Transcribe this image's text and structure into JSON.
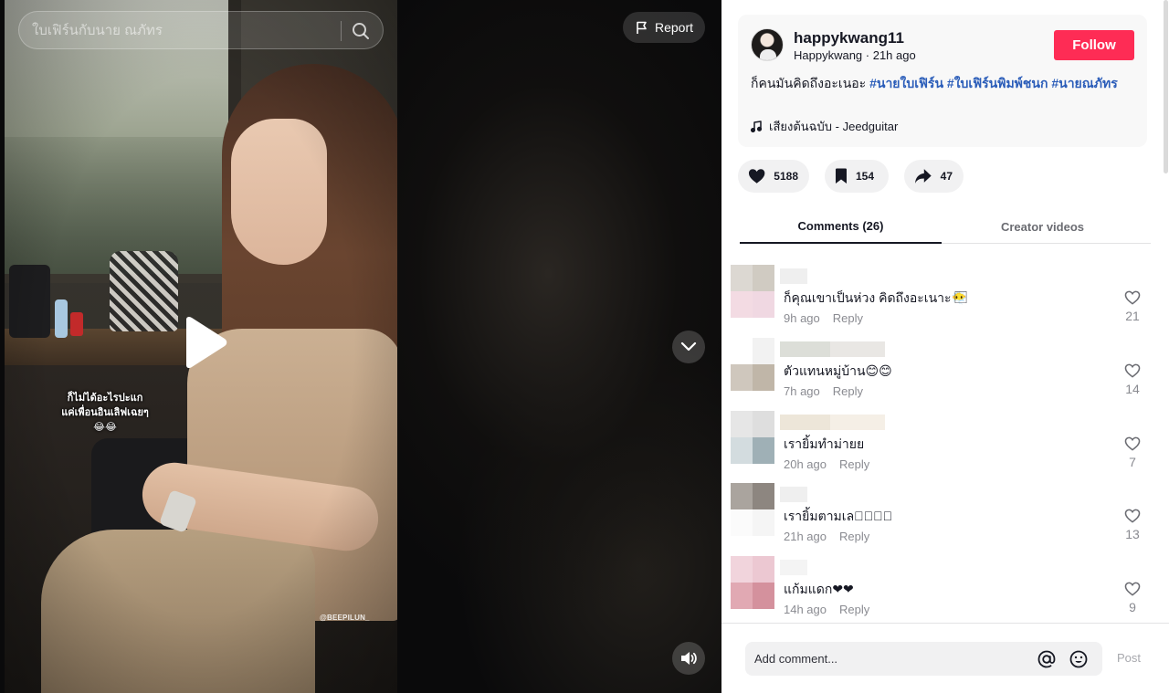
{
  "search": {
    "placeholder": "ใบเฟิร์นกับนาย ณภัทร"
  },
  "video": {
    "overlay_line1": "ก็ไม่ได้อะไรปะแก",
    "overlay_line2": "แค่เพื่อนอินเลิฟเฉยๆ",
    "overlay_emoji": "😂😂",
    "watermark": "@BEEPILUN_",
    "report_label": "Report"
  },
  "author": {
    "username": "happykwang11",
    "nickname": "Happykwang",
    "posted": "21h ago",
    "separator": " · ",
    "follow_label": "Follow",
    "caption_text": "ก็คนมันคิดถึงอะเนอะ ",
    "hashtags": [
      "#นายใบเฟิร์น",
      "#ใบเฟิร์นพิมพ์ชนก",
      "#นายณภัทร"
    ],
    "music": "เสียงต้นฉบับ - Jeedguitar"
  },
  "actions": {
    "likes": "5188",
    "saves": "154",
    "shares": "47"
  },
  "tabs": {
    "comments": "Comments (26)",
    "creator": "Creator videos"
  },
  "comments": [
    {
      "text": "ก็คุณเขาเป็นห่วง คิดถึงอะเนาะ😶‍🌫️⃞",
      "time": "9h ago",
      "reply": "Reply",
      "likes": "21",
      "avatar": [
        "#dcd8d2",
        "#d0cbc2",
        "#f3dbe3",
        "#f0d8e2"
      ],
      "name_colors": [
        "#efefef",
        "#efefef"
      ]
    },
    {
      "text": "ตัวแทนหมู่บ้าน😊😊",
      "time": "7h ago",
      "reply": "Reply",
      "likes": "14",
      "avatar": [
        "#ffffff",
        "#f2f2f2",
        "#cfc7bd",
        "#c0b6a8"
      ],
      "name_colors": [
        "#dcded8",
        "#e9e7e4"
      ]
    },
    {
      "text": "เรายิ้มทำม่ายย",
      "time": "20h ago",
      "reply": "Reply",
      "likes": "7",
      "avatar": [
        "#e6e6e6",
        "#dedede",
        "#d3dcdf",
        "#9fb0b6"
      ],
      "name_colors": [
        "#ede6d9",
        "#f5efe6"
      ]
    },
    {
      "text": "เรายิ้มตามเลย⃞⃞⃞",
      "time": "21h ago",
      "reply": "Reply",
      "likes": "13",
      "avatar": [
        "#aaa49e",
        "#8d8680",
        "#fbfbfb",
        "#f5f5f5"
      ],
      "name_colors": [
        "#efefef",
        "#efefef"
      ]
    },
    {
      "text": "แก้มแดก❤❤",
      "time": "14h ago",
      "reply": "Reply",
      "likes": "9",
      "avatar": [
        "#f1d4dc",
        "#ecc8d2",
        "#e1a9b3",
        "#d4919d"
      ],
      "name_colors": [
        "#f4f4f4",
        "#f4f4f4"
      ]
    }
  ],
  "comment_bar": {
    "placeholder": "Add comment...",
    "post_label": "Post"
  },
  "colors": {
    "accent": "#fe2c55",
    "hashtag": "#2b5db9"
  }
}
